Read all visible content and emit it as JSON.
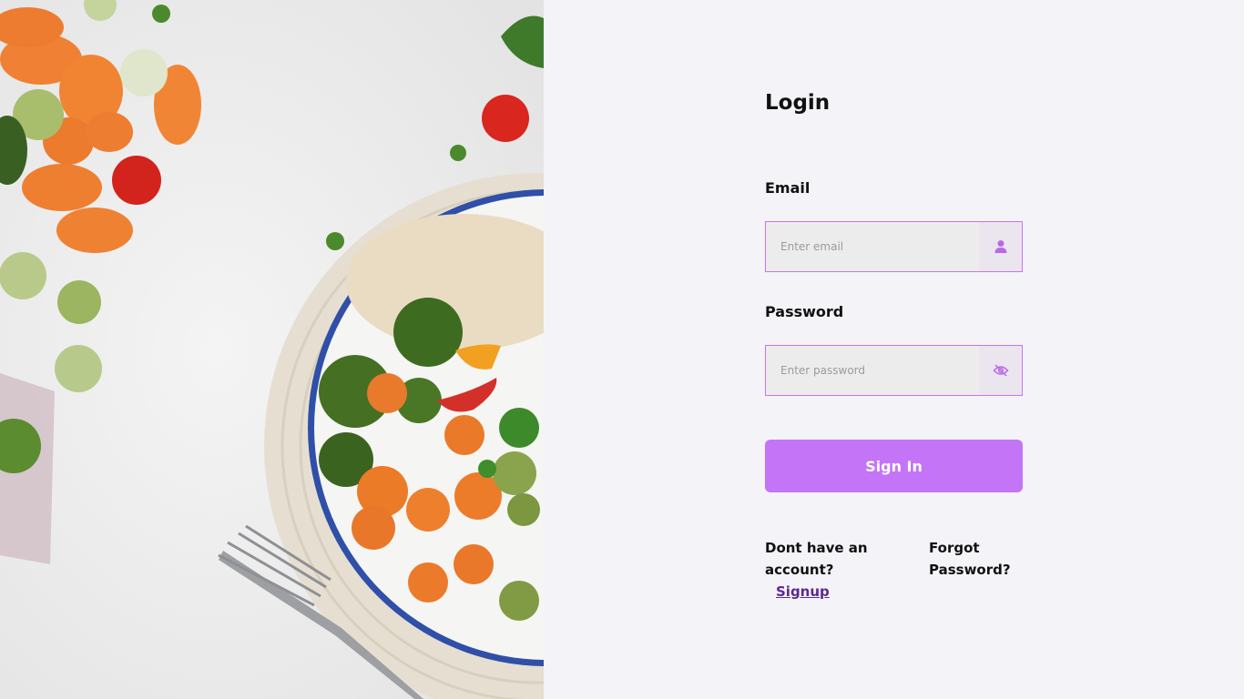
{
  "hero": {
    "image_alt": "Bowl of vegetables, quinoa and fork on a white table"
  },
  "login": {
    "title": "Login",
    "email_label": "Email",
    "email_placeholder": "Enter email",
    "password_label": "Password",
    "password_placeholder": "Enter password",
    "signin_label": "Sign In",
    "no_account_text": "Dont have an account?",
    "signup_link": "Signup",
    "forgot_link": "Forgot Password?"
  },
  "icons": {
    "email": "user-icon",
    "password": "eye-slash-icon"
  },
  "colors": {
    "accent": "#c474f7",
    "field_border": "#c475f5",
    "link": "#5b2a8f",
    "background": "#f4f3f8"
  }
}
